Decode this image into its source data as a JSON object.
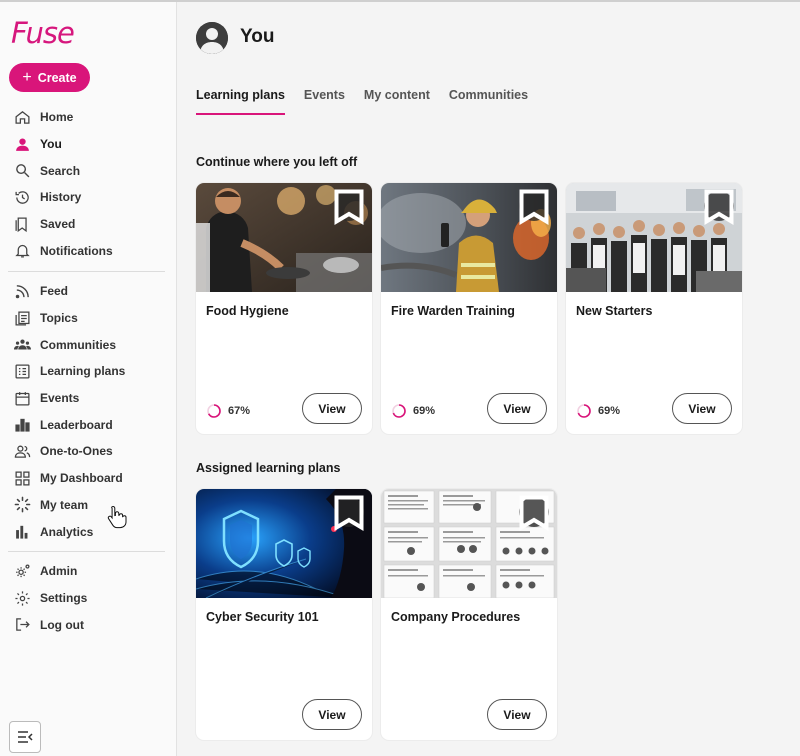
{
  "brand": {
    "logo_text": "Fuse",
    "accent": "#d9157a"
  },
  "sidebar": {
    "create_label": "Create",
    "primary": [
      {
        "label": "Home",
        "icon": "home-icon"
      },
      {
        "label": "You",
        "icon": "person-icon"
      },
      {
        "label": "Search",
        "icon": "search-icon"
      },
      {
        "label": "History",
        "icon": "history-icon"
      },
      {
        "label": "Saved",
        "icon": "bookmark-icon"
      },
      {
        "label": "Notifications",
        "icon": "bell-icon"
      }
    ],
    "secondary": [
      {
        "label": "Feed",
        "icon": "rss-icon"
      },
      {
        "label": "Topics",
        "icon": "topics-icon"
      },
      {
        "label": "Communities",
        "icon": "communities-icon"
      },
      {
        "label": "Learning plans",
        "icon": "learning-plan-icon"
      },
      {
        "label": "Events",
        "icon": "calendar-icon"
      },
      {
        "label": "Leaderboard",
        "icon": "leaderboard-icon"
      },
      {
        "label": "One-to-Ones",
        "icon": "people-icon"
      },
      {
        "label": "My Dashboard",
        "icon": "dashboard-icon"
      },
      {
        "label": "My team",
        "icon": "team-icon"
      },
      {
        "label": "Analytics",
        "icon": "analytics-icon"
      }
    ],
    "tertiary": [
      {
        "label": "Admin",
        "icon": "admin-gear-icon"
      },
      {
        "label": "Settings",
        "icon": "settings-icon"
      },
      {
        "label": "Log out",
        "icon": "logout-icon"
      }
    ]
  },
  "header": {
    "title": "You"
  },
  "tabs": [
    {
      "label": "Learning plans",
      "active": true
    },
    {
      "label": "Events",
      "active": false
    },
    {
      "label": "My content",
      "active": false
    },
    {
      "label": "Communities",
      "active": false
    }
  ],
  "sections": {
    "continue": {
      "title": "Continue where you left off",
      "cards": [
        {
          "title": "Food Hygiene",
          "progress": "67%",
          "progress_value": 0.67,
          "view_label": "View",
          "image": "chef-cooking"
        },
        {
          "title": "Fire Warden Training",
          "progress": "69%",
          "progress_value": 0.69,
          "view_label": "View",
          "image": "firefighter"
        },
        {
          "title": "New Starters",
          "progress": "69%",
          "progress_value": 0.69,
          "view_label": "View",
          "image": "office-group"
        }
      ]
    },
    "assigned": {
      "title": "Assigned learning plans",
      "cards": [
        {
          "title": "Cyber Security 101",
          "view_label": "View",
          "image": "cyber-shield"
        },
        {
          "title": "Company Procedures",
          "view_label": "View",
          "image": "documents"
        }
      ]
    }
  }
}
